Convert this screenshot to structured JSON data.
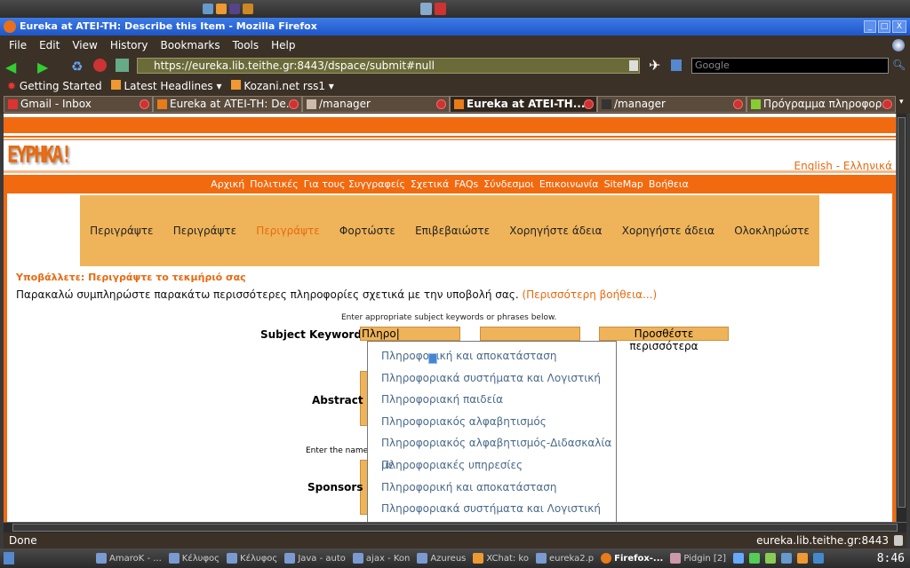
{
  "window": {
    "title": "Eureka at ATEI-TH: Describe this Item - Mozilla Firefox"
  },
  "menu": [
    "File",
    "Edit",
    "View",
    "History",
    "Bookmarks",
    "Tools",
    "Help"
  ],
  "toolbar": {
    "url": "https://eureka.lib.teithe.gr:8443/dspace/submit#null",
    "search_placeholder": "Google"
  },
  "bookmarks": [
    "Getting Started",
    "Latest Headlines",
    "Kozani.net rss1"
  ],
  "tabs": [
    {
      "label": "Gmail - Inbox"
    },
    {
      "label": "Eureka at ATEI-TH: De..."
    },
    {
      "label": "/manager"
    },
    {
      "label": "Eureka at ATEI-TH...",
      "active": true
    },
    {
      "label": "/manager"
    },
    {
      "label": "Πρόγραμμα πληροφορ..."
    }
  ],
  "site": {
    "logo": "ΕΥΡΗΚΑ!",
    "lang_en": "English",
    "lang_sep": " - ",
    "lang_el": "Ελληνικά",
    "nav": [
      "Αρχική",
      "Πολιτικές",
      "Για τους Συγγραφείς",
      "Σχετικά",
      "FAQs",
      "Σύνδεσμοι",
      "Επικοινωνία",
      "SiteMap",
      "Βοήθεια"
    ],
    "steps": [
      {
        "label": "Περιγράψτε"
      },
      {
        "label": "Περιγράψτε"
      },
      {
        "label": "Περιγράψτε",
        "current": true
      },
      {
        "label": "Φορτώστε"
      },
      {
        "label": "Επιβεβαιώστε"
      },
      {
        "label": "Χορηγήστε άδεια"
      },
      {
        "label": "Χορηγήστε άδεια"
      },
      {
        "label": "Ολοκληρώστε"
      }
    ],
    "heading": "Υποβάλλετε: Περιγράψτε το τεκμήριό σας",
    "intro": "Παρακαλώ συμπληρώστε παρακάτω περισσότερες πληροφορίες σχετικά με την υποβολή σας.",
    "help_link": "(Περισσότερη βοήθεια...)",
    "keywords_hint": "Enter appropriate subject keywords or phrases below.",
    "keywords_label": "Subject Keywords",
    "keywords_value": "Πληρο",
    "add_more": "Προσθέστε περισσότερα",
    "abstract_label": "Abstract",
    "names_hint": "Enter the names",
    "sponsors_label": "Sponsors",
    "suggestions": [
      "Πληροφορική και αποκατάσταση",
      "Πληροφοριακά συστήματα και Λογιστική",
      "Πληροφοριακή παιδεία",
      "Πληροφοριακός αλφαβητισμός",
      "Πληροφοριακός αλφαβητισμός-Διδασκαλία με",
      "Πληροφοριακές υπηρεσίες",
      "Πληροφορική και αποκατάσταση",
      "Πληροφοριακά συστήματα και Λογιστική"
    ]
  },
  "status": {
    "left": "Done",
    "right": "eureka.lib.teithe.gr:8443"
  },
  "taskbar": [
    "AmaroK - ...",
    "Κέλυφος",
    "Κέλυφος",
    "Java - auto",
    "ajax - Kon",
    "Azureus",
    "XChat: ko",
    "eureka2.p",
    "Firefox-...",
    "Pidgin [2]"
  ],
  "clock": "8:46",
  "colors": {
    "accent": "#f26a10",
    "steps_bg": "#efb45a",
    "titlebar": "#1f56c8"
  }
}
